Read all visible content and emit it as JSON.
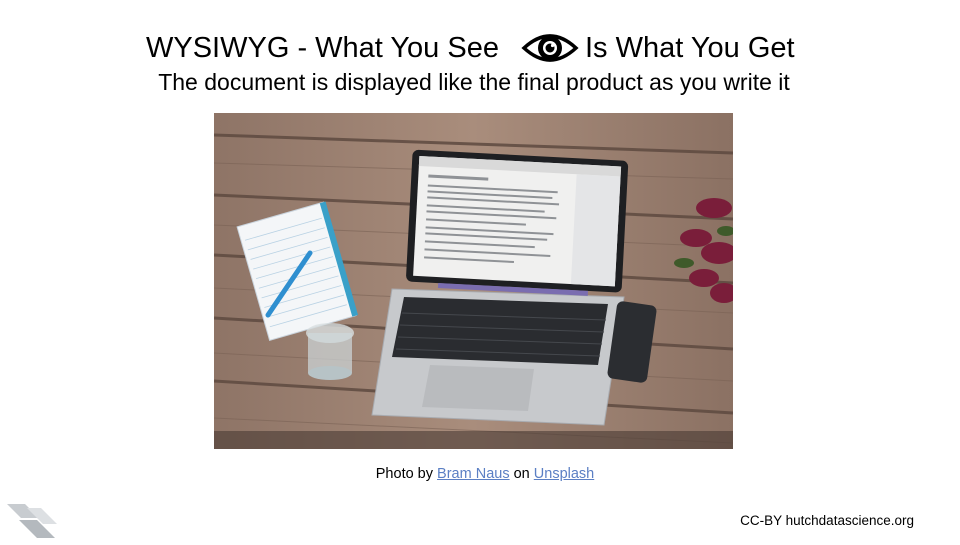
{
  "title": {
    "before_icon": "WYSIWYG - What You See",
    "after_icon": "Is What You Get",
    "icon": "eye-icon"
  },
  "subtitle": "The document is displayed like the final product as you write it",
  "photo": {
    "subject": "laptop-on-wooden-table-photo"
  },
  "credit": {
    "prefix": "Photo by",
    "author": "Bram Naus",
    "middle": "on",
    "site": "Unsplash",
    "link_color": "#5b7fc4"
  },
  "footer": "CC-BY hutchdatascience.org",
  "logo": "hutch-logo-icon"
}
